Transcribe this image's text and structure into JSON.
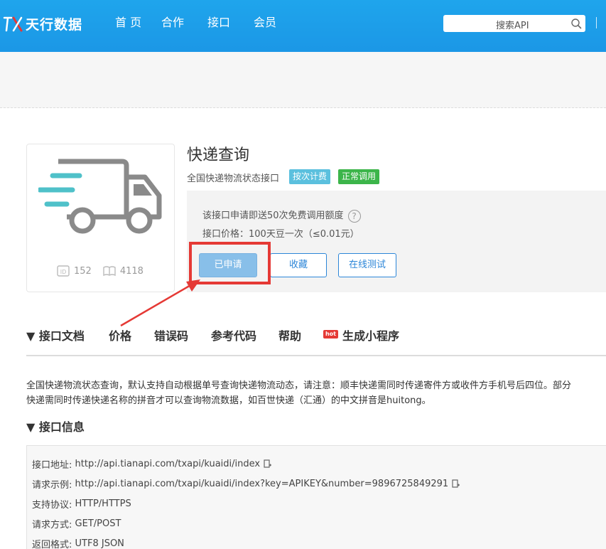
{
  "header": {
    "logo_text": "天行数据",
    "nav": [
      "首 页",
      "合作",
      "接口",
      "会员"
    ],
    "search_placeholder": "搜索API"
  },
  "product": {
    "title": "快递查询",
    "subtitle": "全国快递物流状态接口",
    "tags": {
      "billing": "按次计费",
      "status": "正常调用"
    },
    "stats": {
      "id": "152",
      "views": "4118"
    },
    "info_free_quota": "该接口申请即送50次免费调用额度",
    "info_price": "接口价格：100天豆一次（≤0.01元）",
    "buttons": {
      "applied": "已申请",
      "favorite": "收藏",
      "test": "在线测试"
    }
  },
  "tabs": {
    "docs": "▼ 接口文档",
    "price": "价格",
    "errors": "错误码",
    "code": "参考代码",
    "help": "帮助",
    "hot_badge": "hot",
    "mini_program": "生成小程序"
  },
  "description": {
    "line1": "全国快递物流状态查询，默认支持自动根据单号查询快递物流动态，请注意：顺丰快递需同时传递寄件方或收件方手机号后四位。部分",
    "line2": "快递需同时传递快递名称的拼音才可以查询物流数据，如百世快递（汇通）的中文拼音是huitong。"
  },
  "api_info": {
    "section_title": "▼ 接口信息",
    "rows": [
      {
        "label": "接口地址:",
        "value": "http://api.tianapi.com/txapi/kuaidi/index"
      },
      {
        "label": "请求示例:",
        "value": "http://api.tianapi.com/txapi/kuaidi/index?key=APIKEY&number=9896725849291"
      },
      {
        "label": "支持协议:",
        "value": "HTTP/HTTPS"
      },
      {
        "label": "请求方式:",
        "value": "GET/POST"
      },
      {
        "label": "返回格式:",
        "value": "UTF8 JSON"
      }
    ]
  },
  "colors": {
    "header_blue": "#1b9be8",
    "highlight_red": "#e53935",
    "button_blue": "#2c86d8",
    "applied_blue": "#88bfe9",
    "tag_billing": "#5bc0de",
    "tag_status": "#3cb54a"
  }
}
